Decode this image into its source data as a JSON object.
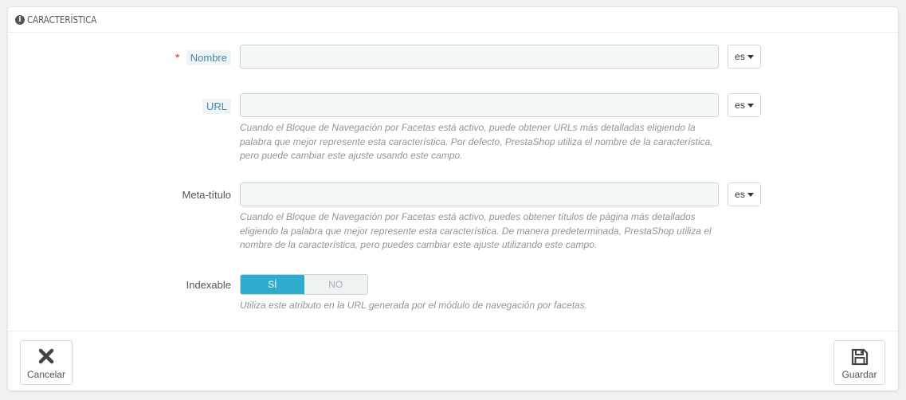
{
  "panel": {
    "title": "CARACTERÍSTICA",
    "icon": "info-icon"
  },
  "form": {
    "name": {
      "required_mark": "*",
      "label": "Nombre",
      "value": "",
      "lang": "es"
    },
    "url": {
      "label": "URL",
      "value": "",
      "lang": "es",
      "help": "Cuando el Bloque de Navegación por Facetas está activo, puede obtener URLs más detalladas eligiendo la palabra que mejor represente esta característica. Por defecto, PrestaShop utiliza el nombre de la característica, pero puede cambiar este ajuste usando este campo."
    },
    "meta_title": {
      "label": "Meta-título",
      "value": "",
      "lang": "es",
      "help": "Cuando el Bloque de Navegación por Facetas está activo, puedes obtener títulos de página más detallados eligiendo la palabra que mejor represente esta característica. De manera predeterminada, PrestaShop utiliza el nombre de la característica, pero puedes cambiar este ajuste utilizando este campo."
    },
    "indexable": {
      "label": "Indexable",
      "yes": "SÍ",
      "no": "NO",
      "selected": "yes",
      "help": "Utiliza este atributo en la URL generada por el módulo de navegación por facetas."
    }
  },
  "footer": {
    "cancel_label": "Cancelar",
    "cancel_icon": "close-icon",
    "save_label": "Guardar",
    "save_icon": "floppy-disk-icon"
  },
  "colors": {
    "accent": "#2eacce",
    "required": "#e22222",
    "hint_label_bg": "#eef5f9",
    "hint_label_text": "#4f85a7"
  }
}
